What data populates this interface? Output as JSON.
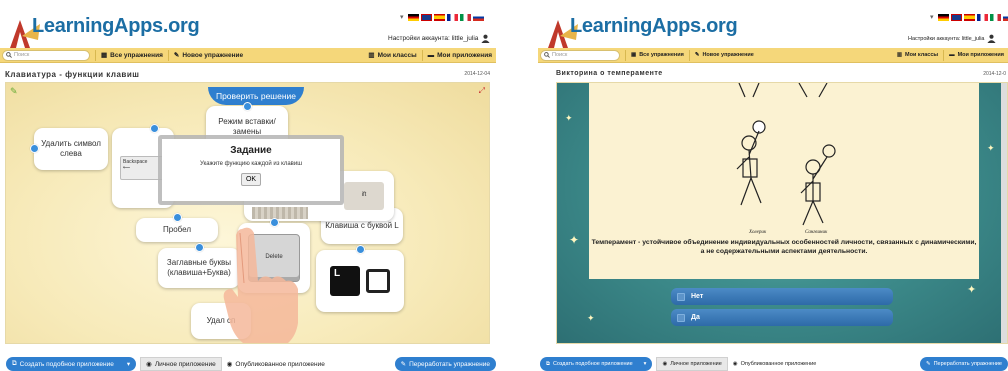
{
  "left": {
    "logo": "LearningApps.org",
    "account": "Настройки аккаунта: little_julia",
    "search_placeholder": "Поиск",
    "nav": {
      "all": "Все упражнения",
      "new": "Новое упражнение",
      "classes": "Мои классы",
      "apps": "Мои приложения"
    },
    "title": "Клавиатура - функции клавиш",
    "date": "2014-12-04",
    "check_button": "Проверить решение",
    "cards": {
      "delete_left": "Удалить символ слева",
      "insert_mode": "Режим вставки/ замены",
      "space": "Пробел",
      "key_l": "Клавиша с буквой L",
      "capitals": "Заглавные буквы (клавиша+Буква)",
      "delete_partial": "Удал сп",
      "backspace_key": "Backspace",
      "delete_key": "Delete",
      "shift_partial": "ift"
    },
    "modal": {
      "title": "Задание",
      "text": "Укажите функцию каждой из клавиш",
      "ok": "OK"
    },
    "bottom": {
      "create": "Создать подобное приложение",
      "private": "Личное приложение",
      "public": "Опубликованное приложение",
      "rework": "Переработать упражнение"
    }
  },
  "right": {
    "logo": "LearningApps.org",
    "account": "Настройки аккаунта: little_julia",
    "search_placeholder": "Поиск",
    "nav": {
      "all": "Все упражнения",
      "new": "Новое упражнение",
      "classes": "Мои классы",
      "apps": "Мои приложения"
    },
    "title": "Викторина о темпераменте",
    "date": "2014-12-0",
    "caption_left": "Холерик",
    "caption_right": "Сангвиник",
    "question": "Темперамент - устойчивое объединение индивидуальных особенностей личности, связанных с динамическими, а не содержательными аспектами деятельности.",
    "answers": [
      "Нет",
      "Да"
    ],
    "bottom": {
      "create": "Создать подобное приложение",
      "private": "Личное приложение",
      "public": "Опубликованное приложение",
      "rework": "Переработать упражнение"
    }
  },
  "colors": {
    "accent": "#2f7fcf",
    "navbar": "#f5d77a",
    "logo": "#1c6ea4"
  }
}
